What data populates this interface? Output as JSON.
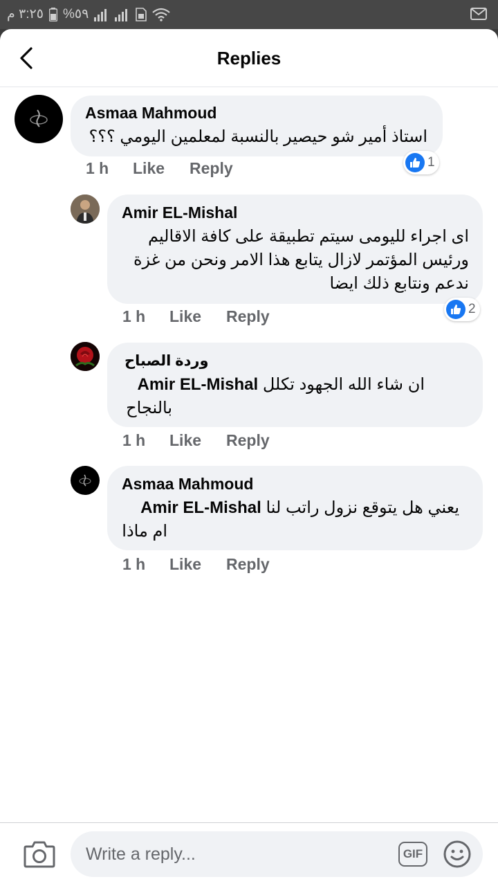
{
  "status_bar": {
    "time": "٣:٢٥ م",
    "battery": "%٥٩"
  },
  "header": {
    "title": "Replies"
  },
  "comments": [
    {
      "author": "Asmaa Mahmoud",
      "lines": [
        "استاذ أمير شو حيصير بالنسبة لمعلمين اليومي ؟؟؟"
      ],
      "time": "1 h",
      "like_label": "Like",
      "reply_label": "Reply",
      "reaction_count": "1"
    },
    {
      "author": "Amir EL-Mishal",
      "lines": [
        "اى اجراء لليومى سيتم تطبيقة على كافة الاقاليم",
        "ورئيس المؤتمر لازال يتابع هذا الامر ونحن من غزة",
        "ندعم ونتابع ذلك ايضا"
      ],
      "time": "1 h",
      "like_label": "Like",
      "reply_label": "Reply",
      "reaction_count": "2"
    },
    {
      "author": "وردة الصباح",
      "mention": "Amir EL-Mishal",
      "line1_text": "ان شاء الله الجهود  تكلل",
      "line2": "بالنجاح",
      "time": "1 h",
      "like_label": "Like",
      "reply_label": "Reply"
    },
    {
      "author": "Asmaa Mahmoud",
      "mention": "Amir EL-Mishal",
      "line1_text": "يعني هل يتوقع نزول راتب لنا",
      "line2": "ام ماذا",
      "time": "1 h",
      "like_label": "Like",
      "reply_label": "Reply"
    }
  ],
  "composer": {
    "placeholder": "Write a reply...",
    "gif_label": "GIF"
  },
  "colors": {
    "accent": "#1877f2",
    "bubble": "#f0f2f5",
    "secondary_text": "#65676b"
  }
}
